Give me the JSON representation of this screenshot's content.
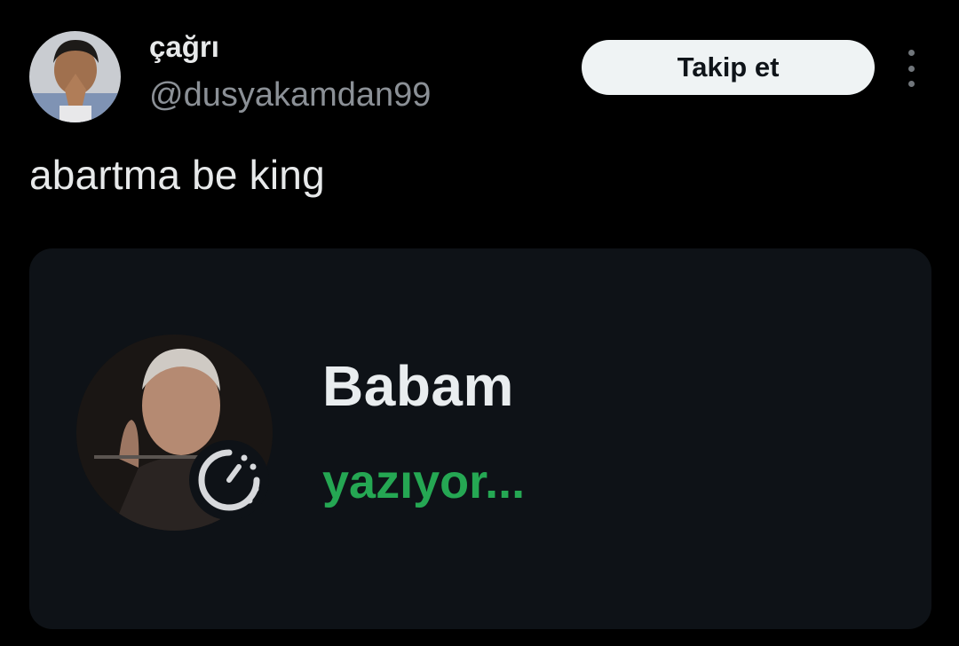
{
  "tweet": {
    "author": {
      "display_name": "çağrı",
      "handle": "@dusyakamdan99",
      "avatar_icon": "profile-photo"
    },
    "follow_label": "Takip et",
    "more_icon": "vertical-ellipsis-icon",
    "text": "abartma be king",
    "media": {
      "contact_name": "Babam",
      "status_text": "yazıyor...",
      "status_color": "#25a753",
      "status_icon": "status-timer-icon"
    }
  }
}
